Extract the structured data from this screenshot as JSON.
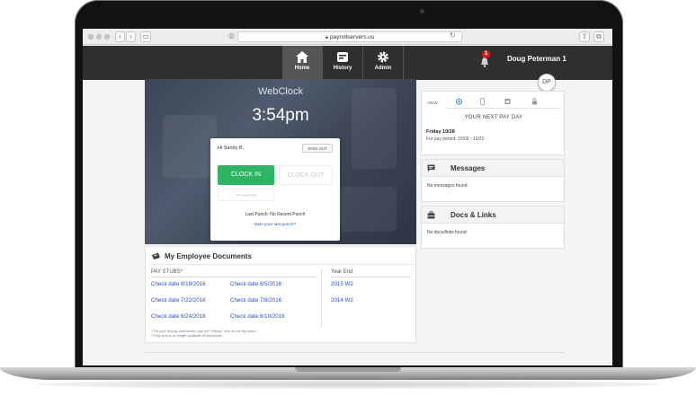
{
  "browser": {
    "url": "payrollservers.us"
  },
  "nav": {
    "items": [
      {
        "label": "Home",
        "icon": "home-icon"
      },
      {
        "label": "History",
        "icon": "history-icon"
      },
      {
        "label": "Admin",
        "icon": "gear-icon"
      }
    ],
    "notification_count": "1",
    "user_name": "Doug Peterman 1",
    "avatar_initials": "DP"
  },
  "webclock": {
    "title": "WebClock",
    "time": "3:54pm",
    "greeting": "Hi Sandy B,",
    "sign_out": "SIGN OUT",
    "clock_in": "CLOCK IN",
    "clock_out": "CLOCK OUT",
    "transfer": "TRANSFER",
    "last_punch": "Last Punch: No Recent Punch",
    "miss_link": "Miss your last punch?"
  },
  "documents": {
    "title": "My Employee Documents",
    "pay_stubs_header": "PAY STUBS*",
    "year_end_header": "Year End",
    "pay_stubs": [
      "Check date 8/19/2016",
      "Check date 8/5/2016",
      "Check date 7/22/2016",
      "Check date 7/8/2016",
      "Check date 6/24/2016",
      "Check date 6/10/2016"
    ],
    "year_end": [
      "2015 W2",
      "2014 W2"
    ],
    "note1": "* For your full pay stub history, use the \"History\" icon on the top menu.",
    "note2": "** Pay stub is no longer available for download."
  },
  "payday": {
    "view_label": "VIEW:",
    "heading": "YOUR NEXT PAY DAY",
    "date": "Friday 10/28",
    "period": "For pay period: 10/09 - 10/22"
  },
  "messages": {
    "title": "Messages",
    "empty": "No messages found"
  },
  "links": {
    "title": "Docs & Links",
    "empty": "No docs/links found"
  },
  "colors": {
    "accent_green": "#2db564",
    "link_blue": "#2b4fd0",
    "nav_bg": "#2f2f2f",
    "alert_red": "#d62020"
  }
}
